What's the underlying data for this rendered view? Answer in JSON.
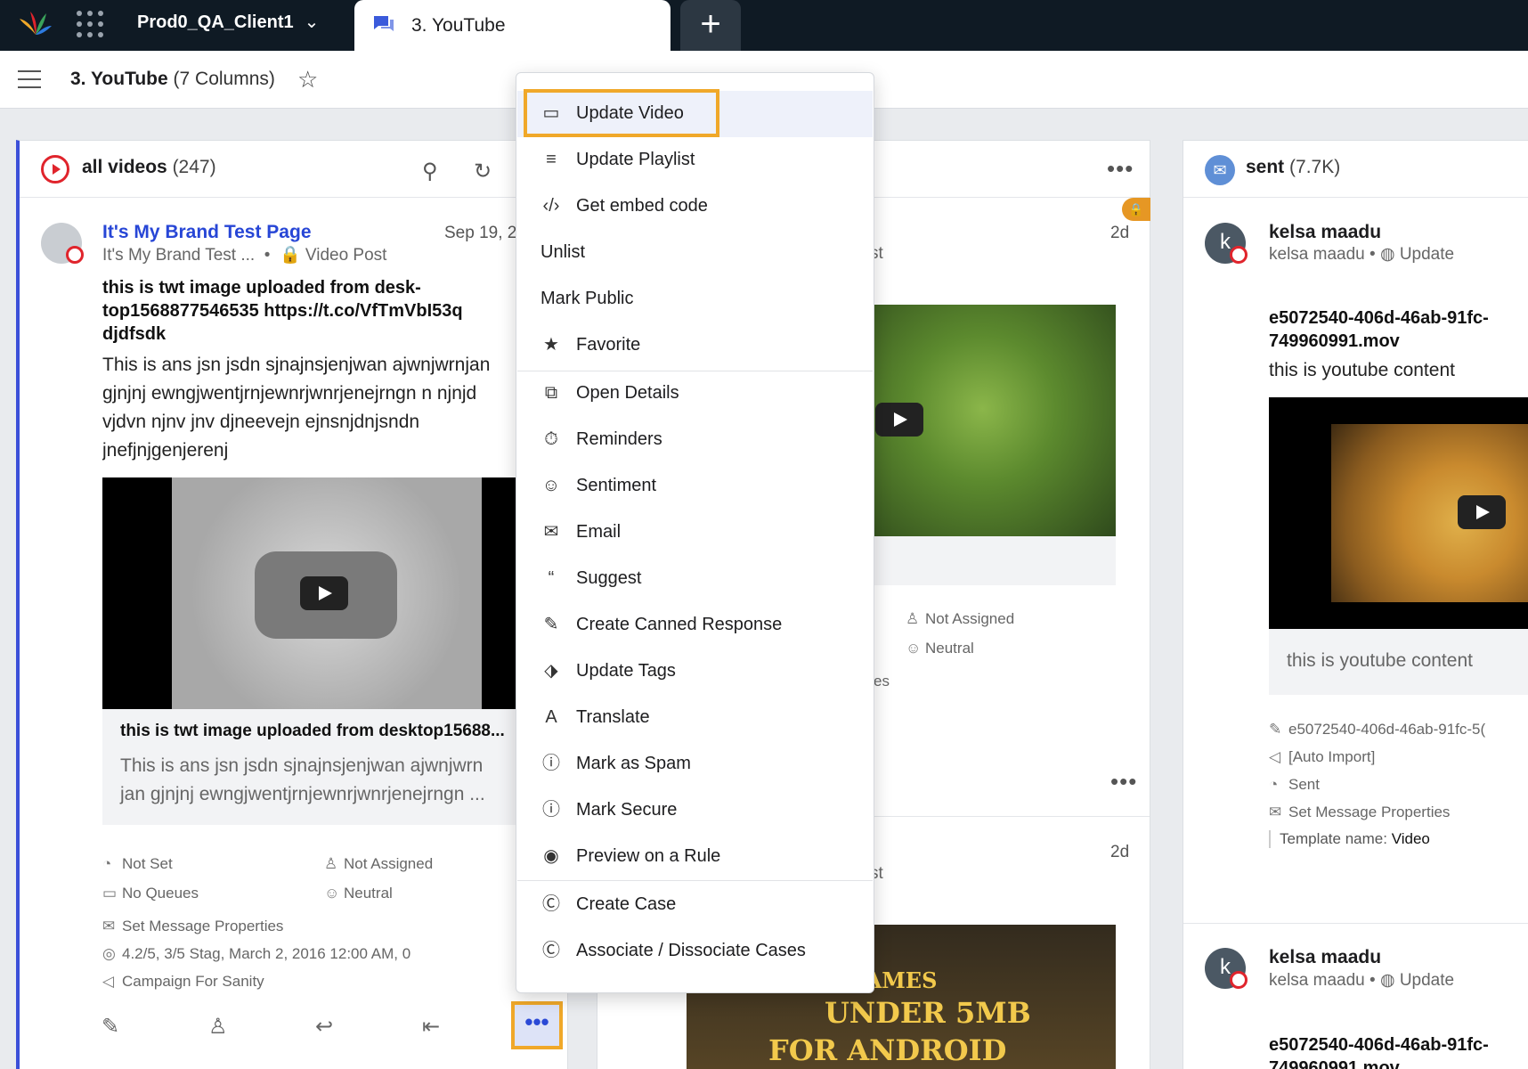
{
  "topbar": {
    "workspace": "Prod0_QA_Client1",
    "tab_label": "3. YouTube",
    "plus": "+"
  },
  "subbar": {
    "title": "3. YouTube",
    "columns": "(7 Columns)"
  },
  "column1": {
    "title": "all videos",
    "count": "(247)",
    "post": {
      "author": "It's My Brand Test Page",
      "sub": "It's My Brand Test ...",
      "type": "Video Post",
      "date": "Sep 19, 2",
      "bold_lines": [
        "this is twt image uploaded from desk-",
        "top1568877546535 https://t.co/VfTmVbI53q",
        "djdfsdk"
      ],
      "body_lines": [
        "This is ans jsn jsdn sjnajnsjenjwan ajwnjwrnjan",
        "gjnjnj ewngjwentjrnjewnrjwnrjenejrngn n njnjd",
        "vjdvn njnv jnv djneevejn ejnsnjdnjsndn",
        "jnefjnjgenjerenj"
      ],
      "card_title": "this is twt image uploaded from desktop15688...",
      "card_lines": [
        "This is ans jsn jsdn sjnajnsjenjwan ajwnjwrn",
        "jan gjnjnj ewngjwentjrnjewnrjwnrjenejrngn ..."
      ],
      "meta": {
        "status": "Not Set",
        "assignee": "Not Assigned",
        "queues": "No Queues",
        "sentiment": "Neutral",
        "properties": "Set Message Properties",
        "rating": "4.2/5, 3/5 Stag, March 2, 2016 12:00 AM, 0",
        "campaign": "Campaign For Sanity"
      },
      "more_button": "•••"
    }
  },
  "column2": {
    "date1": "2d",
    "frag1": "st",
    "assignee": "Not Assigned",
    "sentiment": "Neutral",
    "frag2": "es",
    "date2": "2d",
    "frag3": "st",
    "video_text": [
      "BEST GAMES",
      "UNDER 5MB",
      "FOR ANDROID"
    ]
  },
  "column3": {
    "title": "sent",
    "count": "(7.7K)",
    "post1": {
      "avatar": "k",
      "author": "kelsa maadu",
      "sub": "kelsa maadu",
      "action": "Update",
      "file_lines": [
        "e5072540-406d-46ab-91fc-",
        "749960991.mov"
      ],
      "content": "this is youtube content",
      "card_content": "this is youtube content",
      "meta": {
        "file": "e5072540-406d-46ab-91fc-5(",
        "import": "[Auto Import]",
        "status": "Sent",
        "properties": "Set Message Properties",
        "template_label": "Template name:",
        "template_value": "Video"
      }
    },
    "post2": {
      "avatar": "k",
      "author": "kelsa maadu",
      "sub": "kelsa maadu",
      "action": "Update",
      "file_lines": [
        "e5072540-406d-46ab-91fc-",
        "749960991.mov"
      ]
    }
  },
  "menu": {
    "items": [
      {
        "label": "Update Video",
        "icon": "video-icon"
      },
      {
        "label": "Update Playlist",
        "icon": "playlist-icon"
      },
      {
        "label": "Get embed code",
        "icon": "code-icon"
      },
      {
        "label": "Unlist"
      },
      {
        "label": "Mark Public"
      },
      {
        "label": "Favorite",
        "icon": "star-icon"
      },
      {
        "label": "Open Details",
        "icon": "open-details-icon"
      },
      {
        "label": "Reminders",
        "icon": "timer-icon"
      },
      {
        "label": "Sentiment",
        "icon": "sentiment-icon"
      },
      {
        "label": "Email",
        "icon": "email-icon"
      },
      {
        "label": "Suggest",
        "icon": "quote-icon"
      },
      {
        "label": "Create Canned Response",
        "icon": "edit-icon"
      },
      {
        "label": "Update Tags",
        "icon": "tag-icon"
      },
      {
        "label": "Translate",
        "icon": "translate-icon"
      },
      {
        "label": "Mark as Spam",
        "icon": "alert-icon"
      },
      {
        "label": "Mark Secure",
        "icon": "alert-icon"
      },
      {
        "label": "Preview on a Rule",
        "icon": "eye-icon"
      },
      {
        "label": "Create Case",
        "icon": "case-icon"
      },
      {
        "label": "Associate / Dissociate Cases",
        "icon": "case-icon"
      }
    ]
  },
  "colors": {
    "accent": "#2746d6",
    "highlight": "#f0a829",
    "youtube": "#e0242c",
    "topbar": "#0f1a24"
  }
}
